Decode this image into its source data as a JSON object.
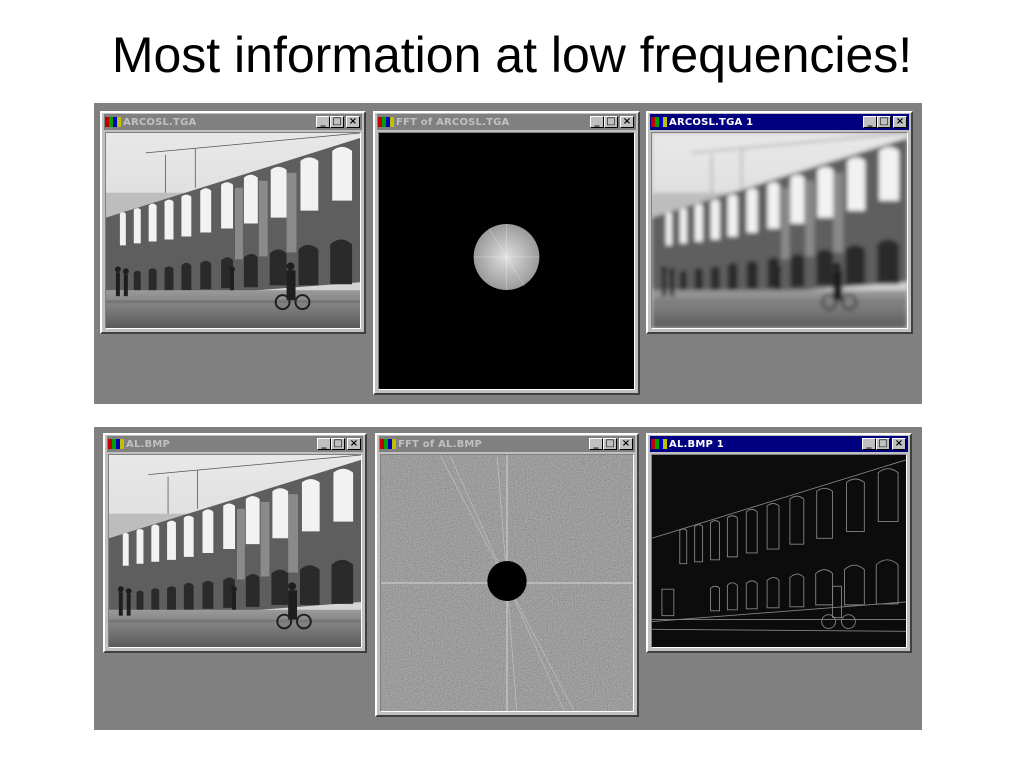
{
  "slide": {
    "title": "Most information at low frequencies!"
  },
  "colors": {
    "panel": "#808080",
    "window": "#c0c0c0",
    "active_titlebar": "#000080",
    "inactive_titlebar": "#808080"
  },
  "rows": [
    {
      "windows": [
        {
          "title": "ARCOSL.TGA",
          "active": false,
          "content": "original photo"
        },
        {
          "title": "FFT of ARCOSL.TGA",
          "active": false,
          "content": "low-pass spectrum disc"
        },
        {
          "title": "ARCOSL.TGA 1",
          "active": true,
          "content": "blurred photo"
        }
      ]
    },
    {
      "windows": [
        {
          "title": "AL.BMP",
          "active": false,
          "content": "original photo"
        },
        {
          "title": "FFT of AL.BMP",
          "active": false,
          "content": "high-pass spectrum with black center"
        },
        {
          "title": "AL.BMP 1",
          "active": true,
          "content": "edge image"
        }
      ]
    }
  ],
  "window_controls": {
    "minimize": "minimize-icon",
    "maximize": "maximize-icon",
    "close": "close-icon"
  }
}
